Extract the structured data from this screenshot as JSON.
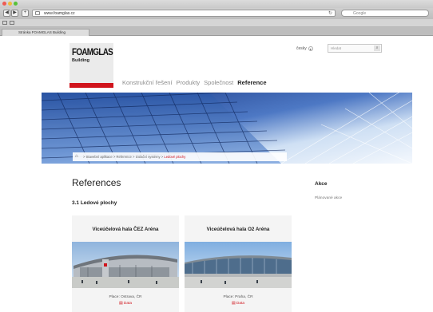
{
  "browser": {
    "url": "www.foamglas.cz",
    "search_placeholder": "Google",
    "tab_label": "Stránka FOAMGLAS Building"
  },
  "header": {
    "logo_title": "FOAMGLAS",
    "logo_sub": "Building",
    "language": "česky",
    "search_placeholder": "Hledat",
    "nav": [
      "Konstrukční řešení",
      "Produkty",
      "Společnost",
      "Reference"
    ]
  },
  "breadcrumb": {
    "items": [
      "Stavební aplikace",
      "Reference",
      "Izolační systémy",
      "Ledové plochy"
    ],
    "separator": ">"
  },
  "main": {
    "title": "References",
    "subtitle": "3.1 Ledové plochy",
    "cards": [
      {
        "title": "Viceúčelová hala ČEZ Aréna",
        "place": "Place: Ostrava, ČR",
        "data": "Data"
      },
      {
        "title": "Viceúčelová hala O2 Aréna",
        "place": "Place: Praha, ČR",
        "data": "Data"
      }
    ]
  },
  "sidebar": {
    "title": "Akce",
    "link": "Plánované akce"
  },
  "colors": {
    "brand_red": "#d0141c",
    "hero_blue": "#1e3e8a"
  }
}
